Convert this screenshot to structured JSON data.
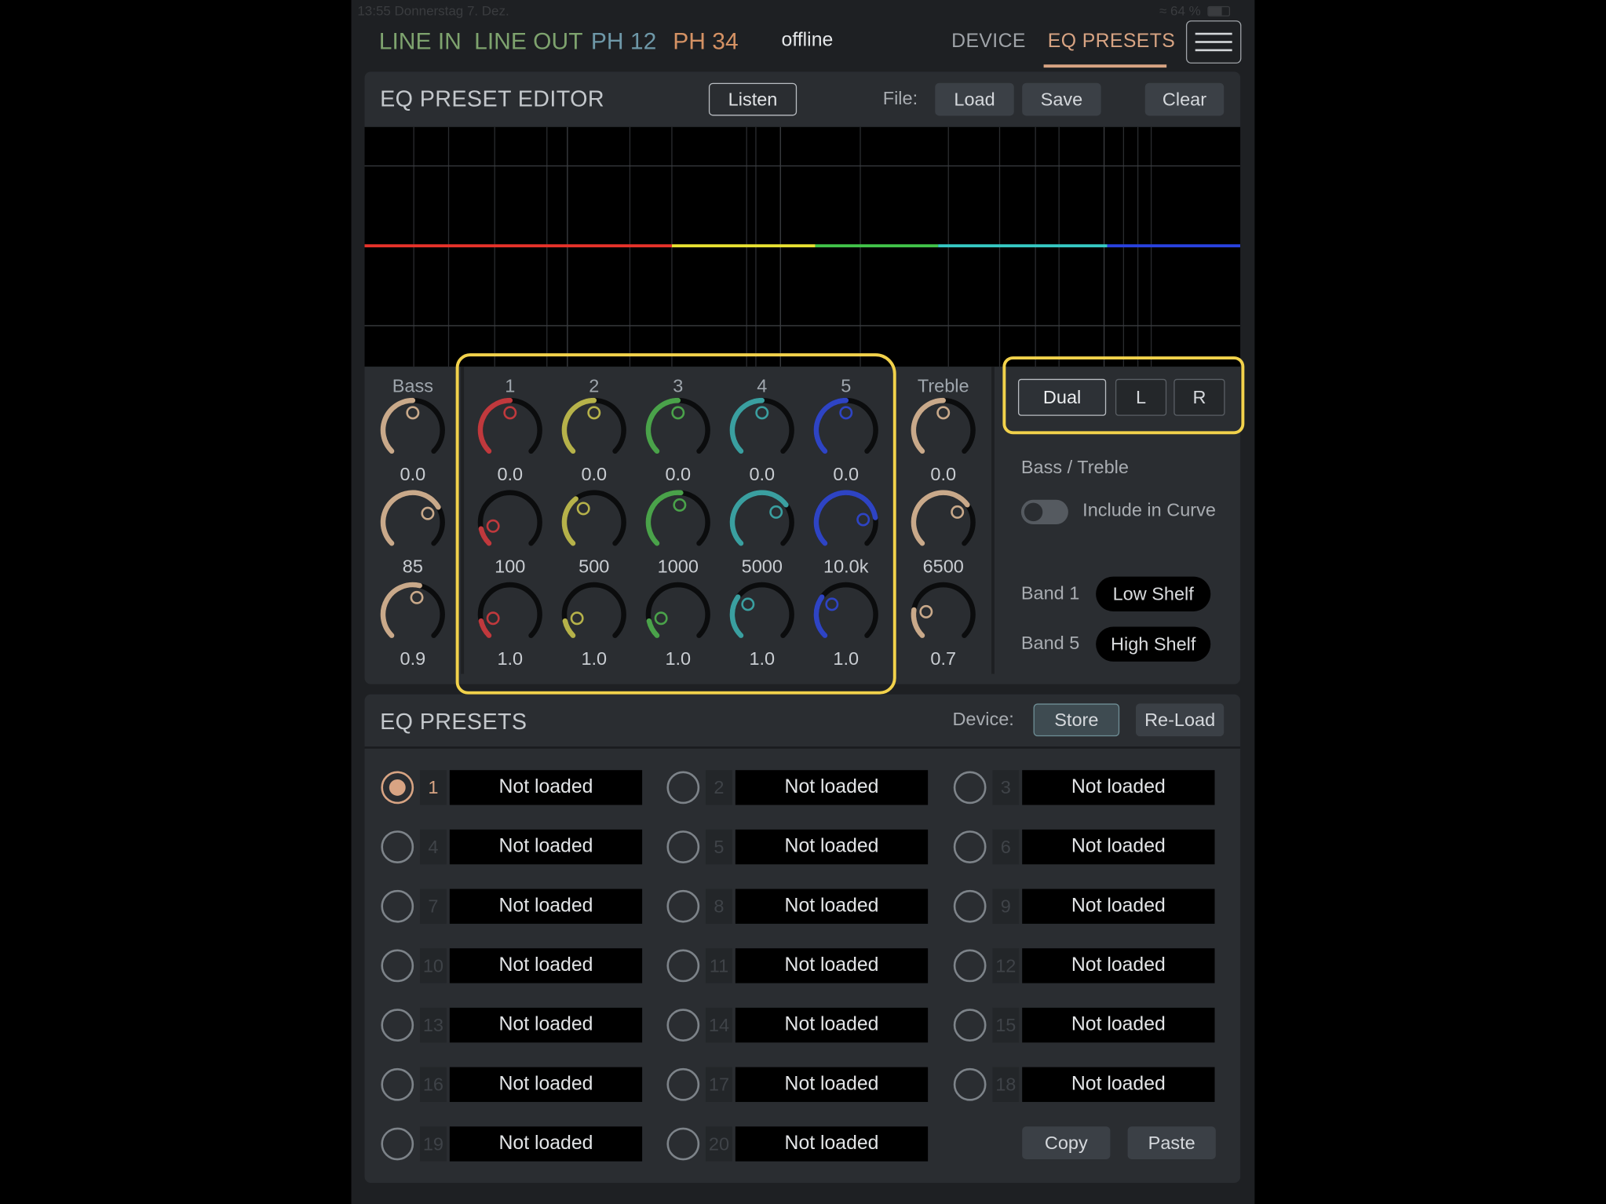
{
  "status_bar": {
    "time_date": "13:55   Donnerstag 7. Dez.",
    "battery": "64 %"
  },
  "nav": {
    "items": [
      {
        "label": "LINE IN",
        "color": "#7ea36e"
      },
      {
        "label": "LINE OUT",
        "color": "#7ea36e"
      },
      {
        "label": "PH 12",
        "color": "#6e98a8"
      },
      {
        "label": "PH 34",
        "color": "#d59264"
      }
    ],
    "status": "offline",
    "tabs": [
      {
        "label": "DEVICE",
        "active": false
      },
      {
        "label": "EQ PRESETS",
        "active": true
      }
    ]
  },
  "editor": {
    "title": "EQ PRESET EDITOR",
    "listen_label": "Listen",
    "file_label": "File:",
    "load_label": "Load",
    "save_label": "Save",
    "clear_label": "Clear",
    "curve_colors": [
      "#e8322a",
      "#e9e332",
      "#42c54a",
      "#36c9c4",
      "#2942e0"
    ],
    "columns": [
      {
        "header": "Bass",
        "color": "#c9a98a",
        "gain": "0.0",
        "gain_level": 0.5,
        "freq": "85",
        "freq_level": 0.72,
        "q": "0.9",
        "q_level": 0.55
      },
      {
        "header": "1",
        "color": "#c0393d",
        "gain": "0.0",
        "gain_level": 0.5,
        "freq": "100",
        "freq_level": 0.12,
        "q": "1.0",
        "q_level": 0.12
      },
      {
        "header": "2",
        "color": "#b6b24a",
        "gain": "0.0",
        "gain_level": 0.5,
        "freq": "500",
        "freq_level": 0.36,
        "q": "1.0",
        "q_level": 0.12
      },
      {
        "header": "3",
        "color": "#4aa24a",
        "gain": "0.0",
        "gain_level": 0.5,
        "freq": "1000",
        "freq_level": 0.52,
        "q": "1.0",
        "q_level": 0.12
      },
      {
        "header": "4",
        "color": "#3a9fa0",
        "gain": "0.0",
        "gain_level": 0.5,
        "freq": "5000",
        "freq_level": 0.7,
        "q": "1.0",
        "q_level": 0.3
      },
      {
        "header": "5",
        "color": "#2e44c4",
        "gain": "0.0",
        "gain_level": 0.5,
        "freq": "10.0k",
        "freq_level": 0.8,
        "q": "1.0",
        "q_level": 0.3
      },
      {
        "header": "Treble",
        "color": "#c9a98a",
        "gain": "0.0",
        "gain_level": 0.5,
        "freq": "6500",
        "freq_level": 0.7,
        "q": "0.7",
        "q_level": 0.2
      }
    ],
    "channel_modes": [
      {
        "label": "Dual",
        "active": true
      },
      {
        "label": "L",
        "active": false
      },
      {
        "label": "R",
        "active": false
      }
    ],
    "bass_treble_label": "Bass / Treble",
    "include_curve_label": "Include in Curve",
    "band1_label": "Band 1",
    "band1_type": "Low Shelf",
    "band5_label": "Band 5",
    "band5_type": "High Shelf"
  },
  "presets": {
    "title": "EQ PRESETS",
    "device_label": "Device:",
    "store_label": "Store",
    "reload_label": "Re-Load",
    "selected": 1,
    "items": [
      {
        "number": "1",
        "name": "Not loaded"
      },
      {
        "number": "2",
        "name": "Not loaded"
      },
      {
        "number": "3",
        "name": "Not loaded"
      },
      {
        "number": "4",
        "name": "Not loaded"
      },
      {
        "number": "5",
        "name": "Not loaded"
      },
      {
        "number": "6",
        "name": "Not loaded"
      },
      {
        "number": "7",
        "name": "Not loaded"
      },
      {
        "number": "8",
        "name": "Not loaded"
      },
      {
        "number": "9",
        "name": "Not loaded"
      },
      {
        "number": "10",
        "name": "Not loaded"
      },
      {
        "number": "11",
        "name": "Not loaded"
      },
      {
        "number": "12",
        "name": "Not loaded"
      },
      {
        "number": "13",
        "name": "Not loaded"
      },
      {
        "number": "14",
        "name": "Not loaded"
      },
      {
        "number": "15",
        "name": "Not loaded"
      },
      {
        "number": "16",
        "name": "Not loaded"
      },
      {
        "number": "17",
        "name": "Not loaded"
      },
      {
        "number": "18",
        "name": "Not loaded"
      },
      {
        "number": "19",
        "name": "Not loaded"
      },
      {
        "number": "20",
        "name": "Not loaded"
      }
    ],
    "copy_label": "Copy",
    "paste_label": "Paste"
  }
}
